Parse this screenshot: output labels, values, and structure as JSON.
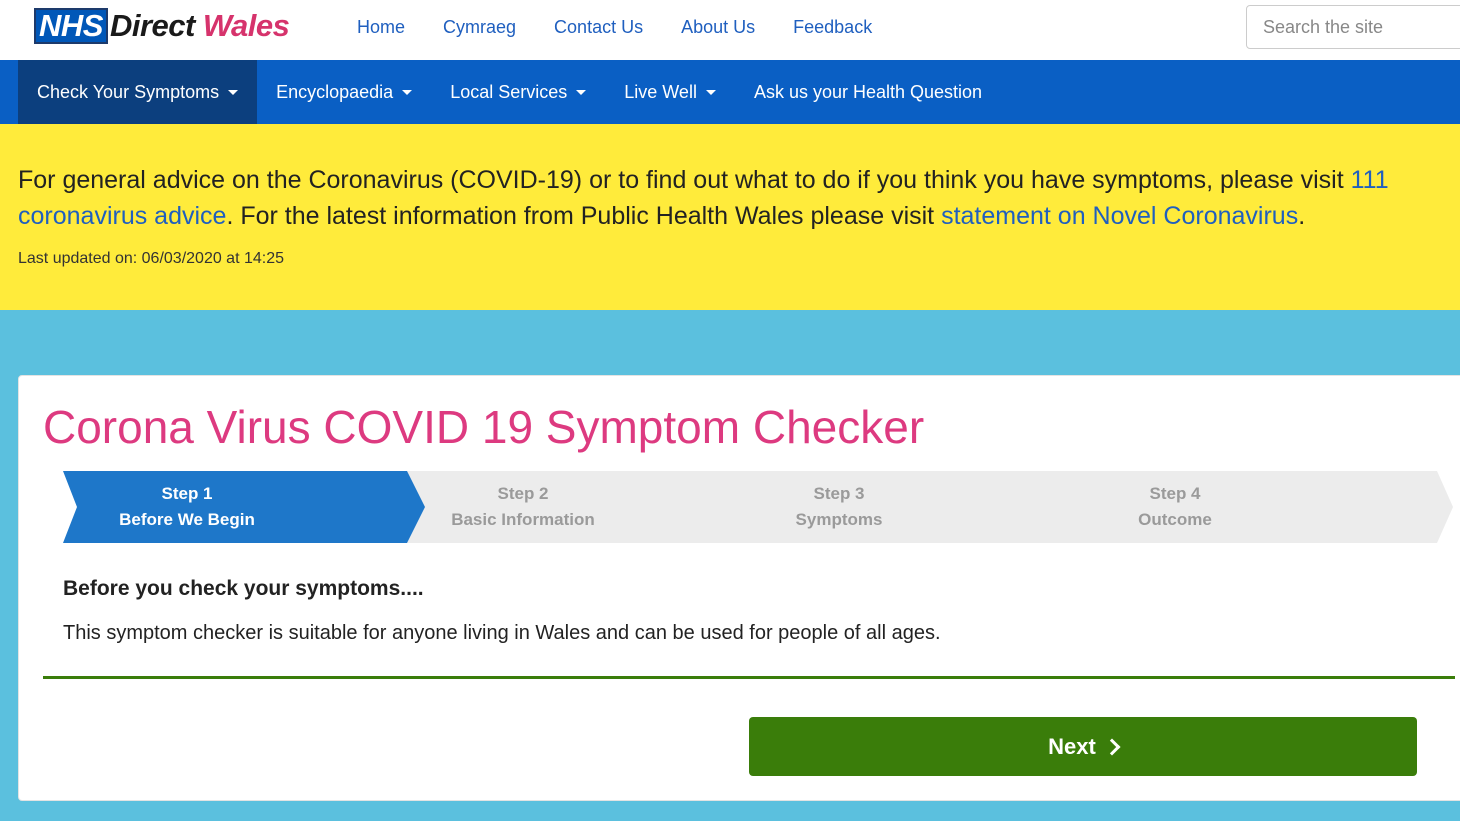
{
  "header": {
    "logo_nhs": "NHS",
    "logo_direct": "Direct",
    "logo_wales": "Wales",
    "links": [
      "Home",
      "Cymraeg",
      "Contact Us",
      "About Us",
      "Feedback"
    ],
    "search_placeholder": "Search the site"
  },
  "nav": {
    "items": [
      {
        "label": "Check Your Symptoms",
        "dropdown": true,
        "active": true
      },
      {
        "label": "Encyclopaedia",
        "dropdown": true,
        "active": false
      },
      {
        "label": "Local Services",
        "dropdown": true,
        "active": false
      },
      {
        "label": "Live Well",
        "dropdown": true,
        "active": false
      },
      {
        "label": "Ask us your Health Question",
        "dropdown": false,
        "active": false
      }
    ]
  },
  "alert": {
    "text_before": "For general advice on the Coronavirus (COVID-19) or to find out what to do if you think you have symptoms, please visit ",
    "link1": "111 coronavirus advice",
    "text_middle": ". For the latest information from Public Health Wales please visit ",
    "link2": "statement on Novel Coronavirus",
    "text_after": ".",
    "updated": "Last updated on: 06/03/2020 at 14:25"
  },
  "checker": {
    "title": "Corona Virus COVID 19 Symptom Checker",
    "steps": [
      {
        "num": "Step 1",
        "name": "Before We Begin",
        "active": true
      },
      {
        "num": "Step 2",
        "name": "Basic Information",
        "active": false
      },
      {
        "num": "Step 3",
        "name": "Symptoms",
        "active": false
      },
      {
        "num": "Step 4",
        "name": "Outcome",
        "active": false
      }
    ],
    "heading": "Before you check your symptoms....",
    "description": "This symptom checker is suitable for anyone living in Wales and can be used for people of all ages.",
    "next_label": "Next"
  },
  "colors": {
    "brand_blue": "#0a5fc4",
    "nav_active": "#0c3f7e",
    "alert_yellow": "#ffeb3b",
    "title_pink": "#dd3a80",
    "button_green": "#3a7d0a",
    "page_bg": "#5bc0de"
  },
  "icons": {
    "dropdown": "caret-down-icon",
    "next": "chevron-right-icon"
  }
}
